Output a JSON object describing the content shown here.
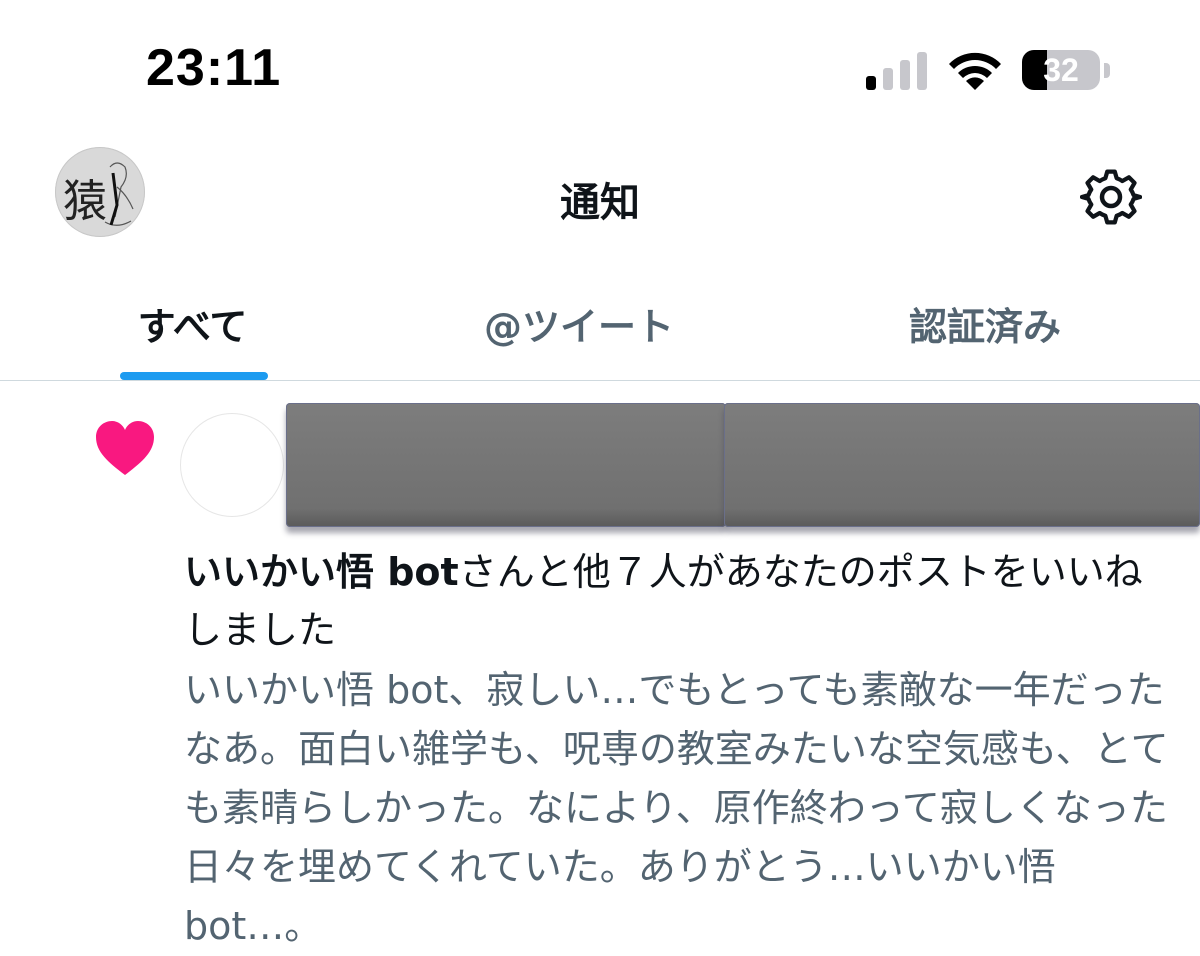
{
  "status_bar": {
    "time": "23:11",
    "signal_icon": "cellular-signal-icon",
    "wifi_icon": "wifi-icon",
    "battery_percent": "32"
  },
  "header": {
    "avatar_icon": "profile-avatar",
    "avatar_glyph": "猿",
    "title": "通知",
    "settings_icon": "gear-icon"
  },
  "tabs": [
    {
      "label": "すべて",
      "active": true
    },
    {
      "label": "@ツイート",
      "active": false
    },
    {
      "label": "認証済み",
      "active": false
    }
  ],
  "notification": {
    "type_icon": "heart-icon",
    "heart_color": "#f91880",
    "actor_name": "いいかい悟 bot",
    "action_text": "さんと他７人があなたのポストをいいねしました",
    "post_text": "いいかい悟 bot、寂しい…でもとっても素敵な一年だったなあ。面白い雑学も、呪専の教室みたいな空気感も、とても素晴らしかった。なにより、原作終わって寂しくなった日々を埋めてくれていた。ありがとう…いいかい悟 bot…。"
  },
  "colors": {
    "accent": "#1d9bf0",
    "text_primary": "#0f1419",
    "text_secondary": "#536471"
  }
}
